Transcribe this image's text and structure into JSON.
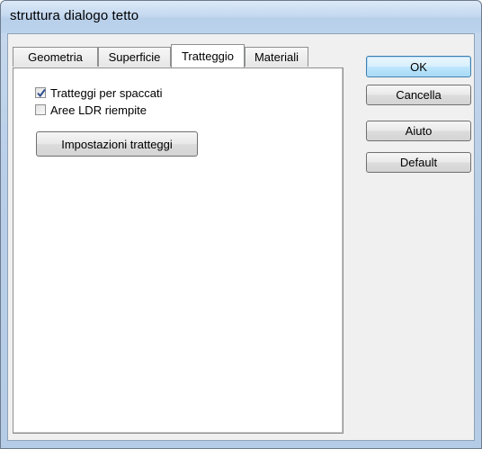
{
  "window": {
    "title": "struttura dialogo tetto"
  },
  "tabs": [
    {
      "label": "Geometria",
      "active": false
    },
    {
      "label": "Superficie",
      "active": false
    },
    {
      "label": "Tratteggio",
      "active": true
    },
    {
      "label": "Materiali",
      "active": false
    }
  ],
  "tratteggio": {
    "checkboxes": [
      {
        "label": "Tratteggi per spaccati",
        "checked": true
      },
      {
        "label": "Aree LDR riempite",
        "checked": false
      }
    ],
    "settings_button": "Impostazioni tratteggi"
  },
  "buttons": {
    "ok": "OK",
    "cancel": "Cancella",
    "help": "Aiuto",
    "default": "Default"
  },
  "colors": {
    "default_button_border": "#3c7fb1",
    "checkmark": "#2f4f8f"
  },
  "icons": {
    "check": "checkmark-icon"
  }
}
